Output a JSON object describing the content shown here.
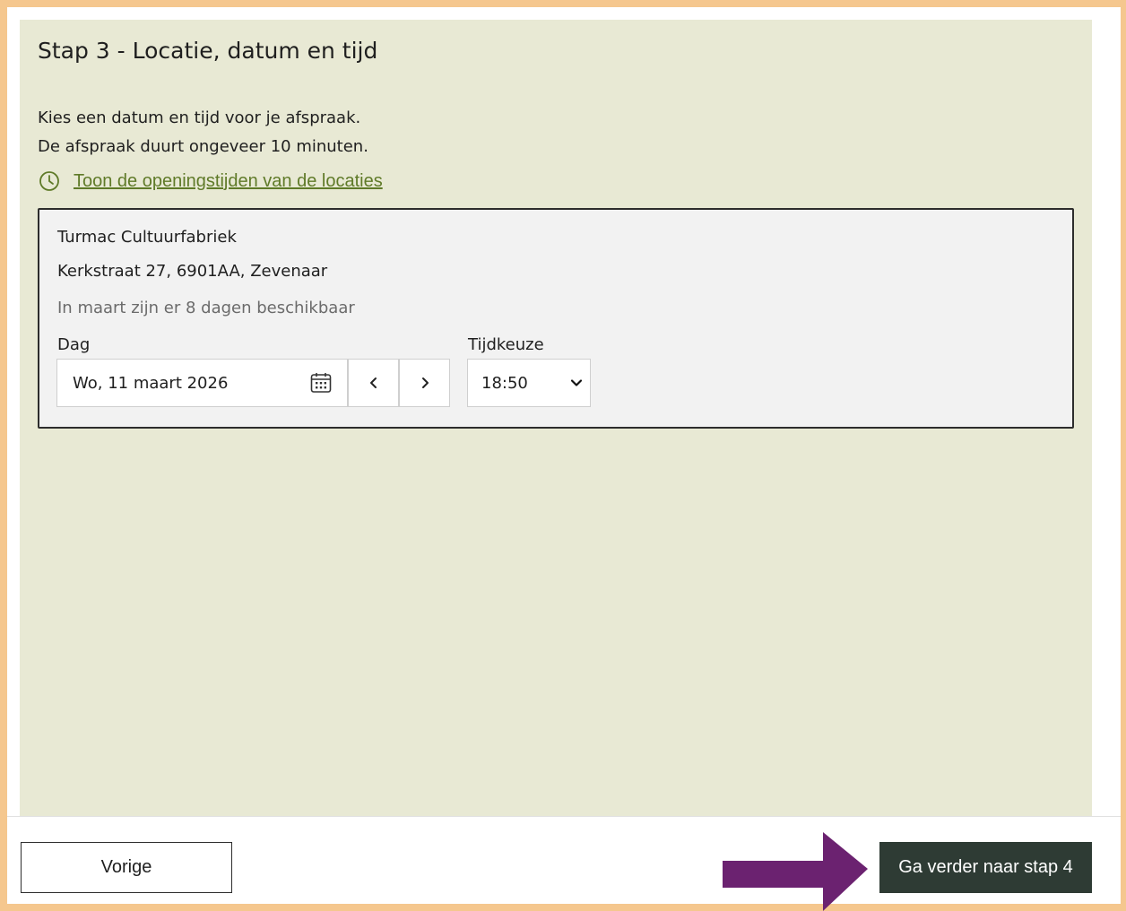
{
  "step": {
    "title": "Stap 3 - Locatie, datum en tijd",
    "intro_line1": "Kies een datum en tijd voor je afspraak.",
    "intro_line2": "De afspraak duurt ongeveer 10 minuten.",
    "hours_link": "Toon de openingstijden van de locaties"
  },
  "location": {
    "name": "Turmac Cultuurfabriek",
    "address": "Kerkstraat 27, 6901AA, Zevenaar",
    "availability": "In maart zijn er 8 dagen beschikbaar",
    "day_label": "Dag",
    "time_label": "Tijdkeuze",
    "selected_date": "Wo, 11 maart 2026",
    "selected_time": "18:50"
  },
  "footer": {
    "prev_label": "Vorige",
    "next_label": "Ga verder naar stap 4"
  },
  "icons": {
    "clock": "clock-icon",
    "calendar": "calendar-icon",
    "prev_day": "chevron-left-icon",
    "next_day": "chevron-right-icon",
    "select": "chevron-down-icon",
    "highlight": "arrow-right-icon"
  },
  "colors": {
    "page_frame": "#f5c78e",
    "panel_background": "#e8e9d4",
    "link": "#5f7a28",
    "primary_button": "#2e3b34",
    "annotation_arrow": "#6b2270"
  }
}
